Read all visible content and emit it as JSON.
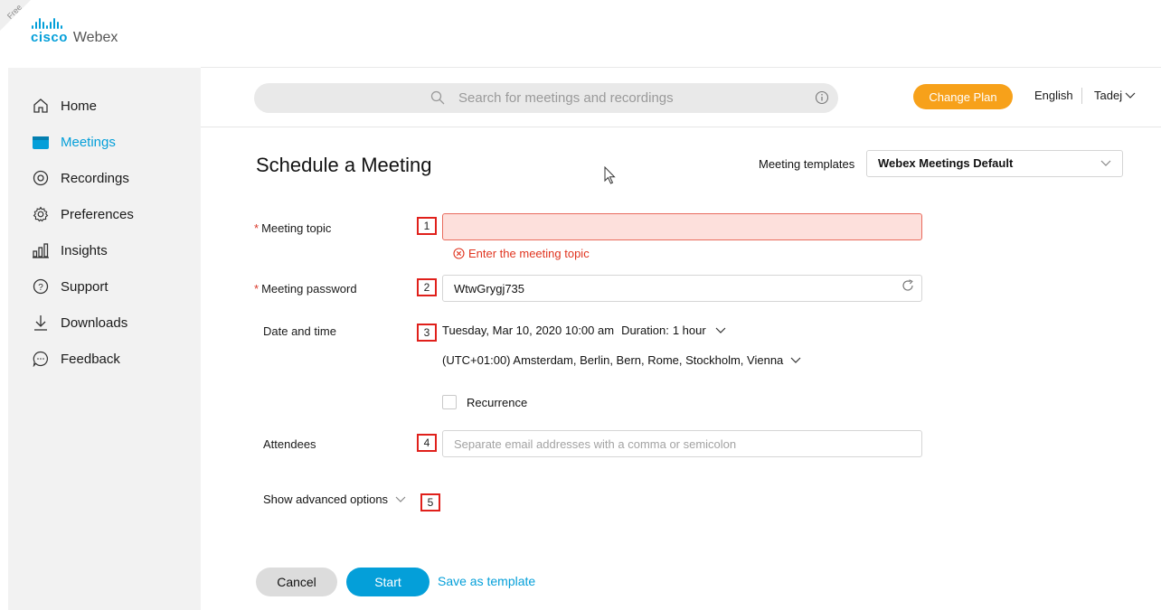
{
  "brand": {
    "free_label": "Free",
    "cisco": "cisco",
    "product": "Webex",
    "color": "#049fd9"
  },
  "sidebar": {
    "items": [
      {
        "label": "Home",
        "icon": "home-icon"
      },
      {
        "label": "Meetings",
        "icon": "calendar-icon",
        "active": true
      },
      {
        "label": "Recordings",
        "icon": "recordings-icon"
      },
      {
        "label": "Preferences",
        "icon": "gear-icon"
      },
      {
        "label": "Insights",
        "icon": "insights-icon"
      },
      {
        "label": "Support",
        "icon": "question-icon"
      },
      {
        "label": "Downloads",
        "icon": "download-icon"
      },
      {
        "label": "Feedback",
        "icon": "chat-icon"
      }
    ]
  },
  "header": {
    "search_placeholder": "Search for meetings and recordings",
    "change_plan": "Change Plan",
    "language": "English",
    "user": "Tadej"
  },
  "main": {
    "title": "Schedule a Meeting",
    "templates_label": "Meeting templates",
    "templates_value": "Webex Meetings Default",
    "topic": {
      "label": "Meeting topic",
      "value": "",
      "error": "Enter the meeting topic",
      "marker": "1"
    },
    "password": {
      "label": "Meeting password",
      "value": "WtwGrygj735",
      "marker": "2"
    },
    "datetime": {
      "label": "Date and time",
      "date": "Tuesday, Mar 10, 2020 10:00 am",
      "duration_label": "Duration:",
      "duration_value": "1 hour",
      "timezone": "(UTC+01:00) Amsterdam, Berlin, Bern, Rome, Stockholm, Vienna",
      "recurrence": "Recurrence",
      "marker": "3"
    },
    "attendees": {
      "label": "Attendees",
      "placeholder": "Separate email addresses with a comma or semicolon",
      "marker": "4"
    },
    "advanced": {
      "label": "Show advanced options",
      "marker": "5"
    },
    "actions": {
      "cancel": "Cancel",
      "start": "Start",
      "save_template": "Save as template"
    }
  },
  "colors": {
    "accent": "#049fd9",
    "orange": "#f7a11a",
    "error": "#e0341f",
    "error_bg": "#fde0dc"
  }
}
